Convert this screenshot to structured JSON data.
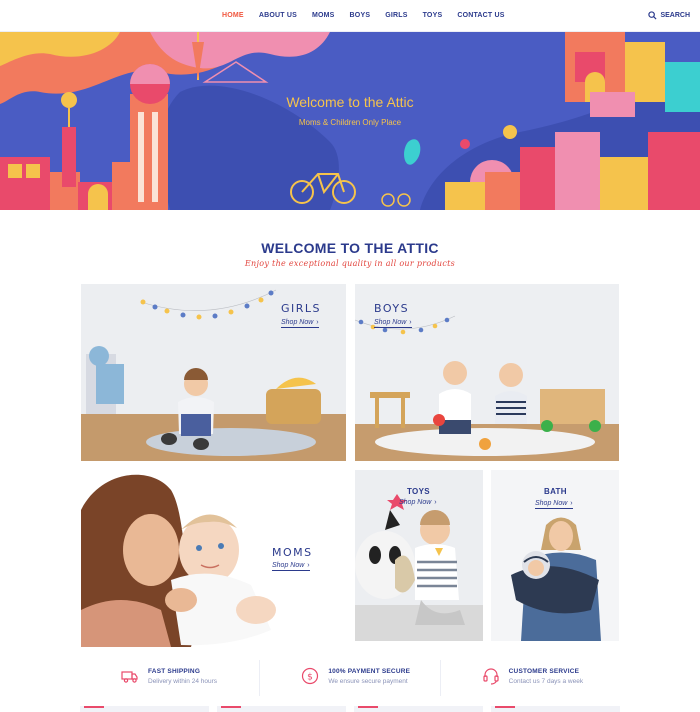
{
  "nav": {
    "items": [
      {
        "label": "HOME",
        "active": true
      },
      {
        "label": "ABOUT US",
        "active": false
      },
      {
        "label": "MOMS",
        "active": false
      },
      {
        "label": "BOYS",
        "active": false
      },
      {
        "label": "GIRLS",
        "active": false
      },
      {
        "label": "TOYS",
        "active": false
      },
      {
        "label": "CONTACT US",
        "active": false
      }
    ],
    "search_label": "SEARCH",
    "search_icon": "search-icon"
  },
  "hero": {
    "title": "Welcome to the Attic",
    "subtitle": "Moms & Children Only Place"
  },
  "section": {
    "title": "WELCOME TO THE ATTIC",
    "subtitle": "Enjoy the exceptional quality in all our products"
  },
  "tiles": {
    "girls": {
      "label": "GIRLS",
      "cta": "Shop Now"
    },
    "boys": {
      "label": "BOYS",
      "cta": "Shop Now"
    },
    "moms": {
      "label": "MOMS",
      "cta": "Shop Now"
    },
    "toys": {
      "label": "TOYS",
      "cta": "Shop Now"
    },
    "bath": {
      "label": "BATH",
      "cta": "Shop Now"
    }
  },
  "features": [
    {
      "icon": "truck-icon",
      "title": "FAST SHIPPING",
      "desc": "Delivery within 24 hours"
    },
    {
      "icon": "dollar-icon",
      "title": "100% PAYMENT SECURE",
      "desc": "We ensure secure payment"
    },
    {
      "icon": "headset-icon",
      "title": "CUSTOMER SERVICE",
      "desc": "Contact us 7 days a week"
    }
  ],
  "colors": {
    "navy": "#2b3a8c",
    "accent": "#f0573f",
    "hero_bg": "#4a5cc3",
    "hero_text": "#f5c34c"
  }
}
